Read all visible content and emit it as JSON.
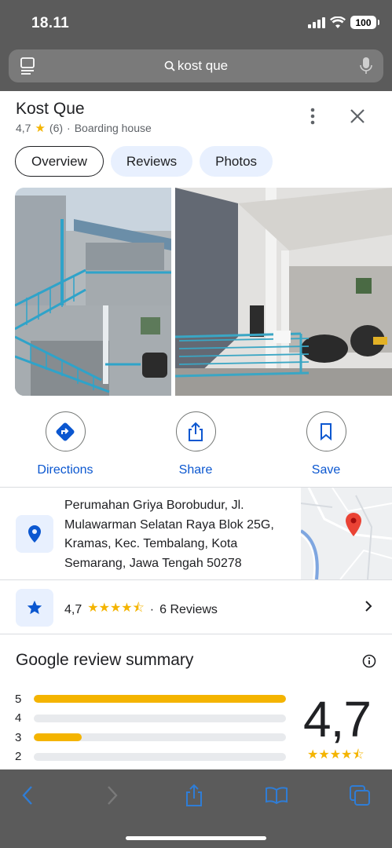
{
  "status_bar": {
    "time": "18.11",
    "battery": "100"
  },
  "url_bar": {
    "query": "kost que"
  },
  "place": {
    "name": "Kost Que",
    "rating": "4,7",
    "review_count": "(6)",
    "separator": "·",
    "category": "Boarding house"
  },
  "tabs": [
    {
      "label": "Overview",
      "active": true
    },
    {
      "label": "Reviews",
      "active": false
    },
    {
      "label": "Photos",
      "active": false
    }
  ],
  "actions": [
    {
      "label": "Directions",
      "icon": "directions-icon"
    },
    {
      "label": "Share",
      "icon": "share-icon"
    },
    {
      "label": "Save",
      "icon": "bookmark-icon"
    }
  ],
  "address": "Perumahan Griya Borobudur, Jl. Mulawarman Selatan Raya Blok 25G, Kramas, Kec. Tembalang, Kota Semarang, Jawa Tengah 50278",
  "rating_row": {
    "rating": "4,7",
    "stars": "★★★★⯪",
    "separator": "·",
    "reviews": "6 Reviews"
  },
  "summary": {
    "title": "Google review summary",
    "bars": [
      {
        "label": "5",
        "fraction": 1.0
      },
      {
        "label": "4",
        "fraction": 0.0
      },
      {
        "label": "3",
        "fraction": 0.19
      },
      {
        "label": "2",
        "fraction": 0.0
      }
    ],
    "average": "4,7",
    "stars": "★★★★⯪"
  },
  "colors": {
    "accent": "#0b57d0",
    "star": "#f4b400",
    "chrome": "#5b5b5b"
  }
}
